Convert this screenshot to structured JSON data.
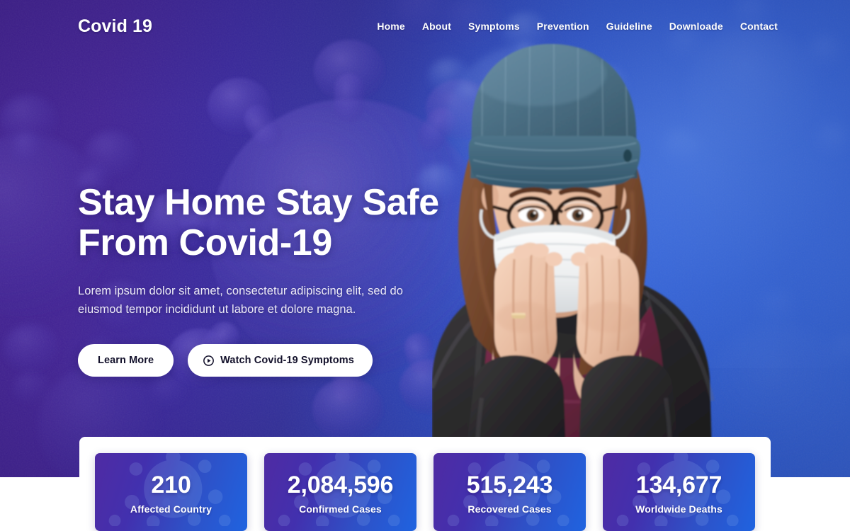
{
  "site": {
    "brand": "Covid 19"
  },
  "nav": {
    "items": [
      {
        "label": "Home"
      },
      {
        "label": "About"
      },
      {
        "label": "Symptoms"
      },
      {
        "label": "Prevention"
      },
      {
        "label": "Guideline"
      },
      {
        "label": "Downloade"
      },
      {
        "label": "Contact"
      }
    ]
  },
  "hero": {
    "title_line1": "Stay Home Stay Safe",
    "title_line2": "From Covid-19",
    "description": "Lorem ipsum dolor sit amet, consectetur adipiscing elit, sed do eiusmod tempor incididunt ut labore et dolore magna.",
    "primary_button": "Learn More",
    "secondary_button": "Watch Covid-19 Symptoms",
    "secondary_button_icon": "play-circle-icon",
    "image_alt": "Woman wearing teal beanie, eyeglasses and white face mask covering her face with both hands, maroon scarf and dark winter jacket"
  },
  "stats": {
    "cards": [
      {
        "value": "210",
        "label": "Affected Country"
      },
      {
        "value": "2,084,596",
        "label": "Confirmed Cases"
      },
      {
        "value": "515,243",
        "label": "Recovered Cases"
      },
      {
        "value": "134,677",
        "label": "Worldwide Deaths"
      }
    ]
  },
  "colors": {
    "hero_gradient_start": "#41218f",
    "hero_gradient_end": "#356ade",
    "card_gradient_start": "#4f2ba3",
    "card_gradient_end": "#1f63e0",
    "button_bg": "#ffffff",
    "button_text": "#12102a",
    "panel_bg": "#ffffff",
    "text_on_hero": "#ffffff"
  }
}
